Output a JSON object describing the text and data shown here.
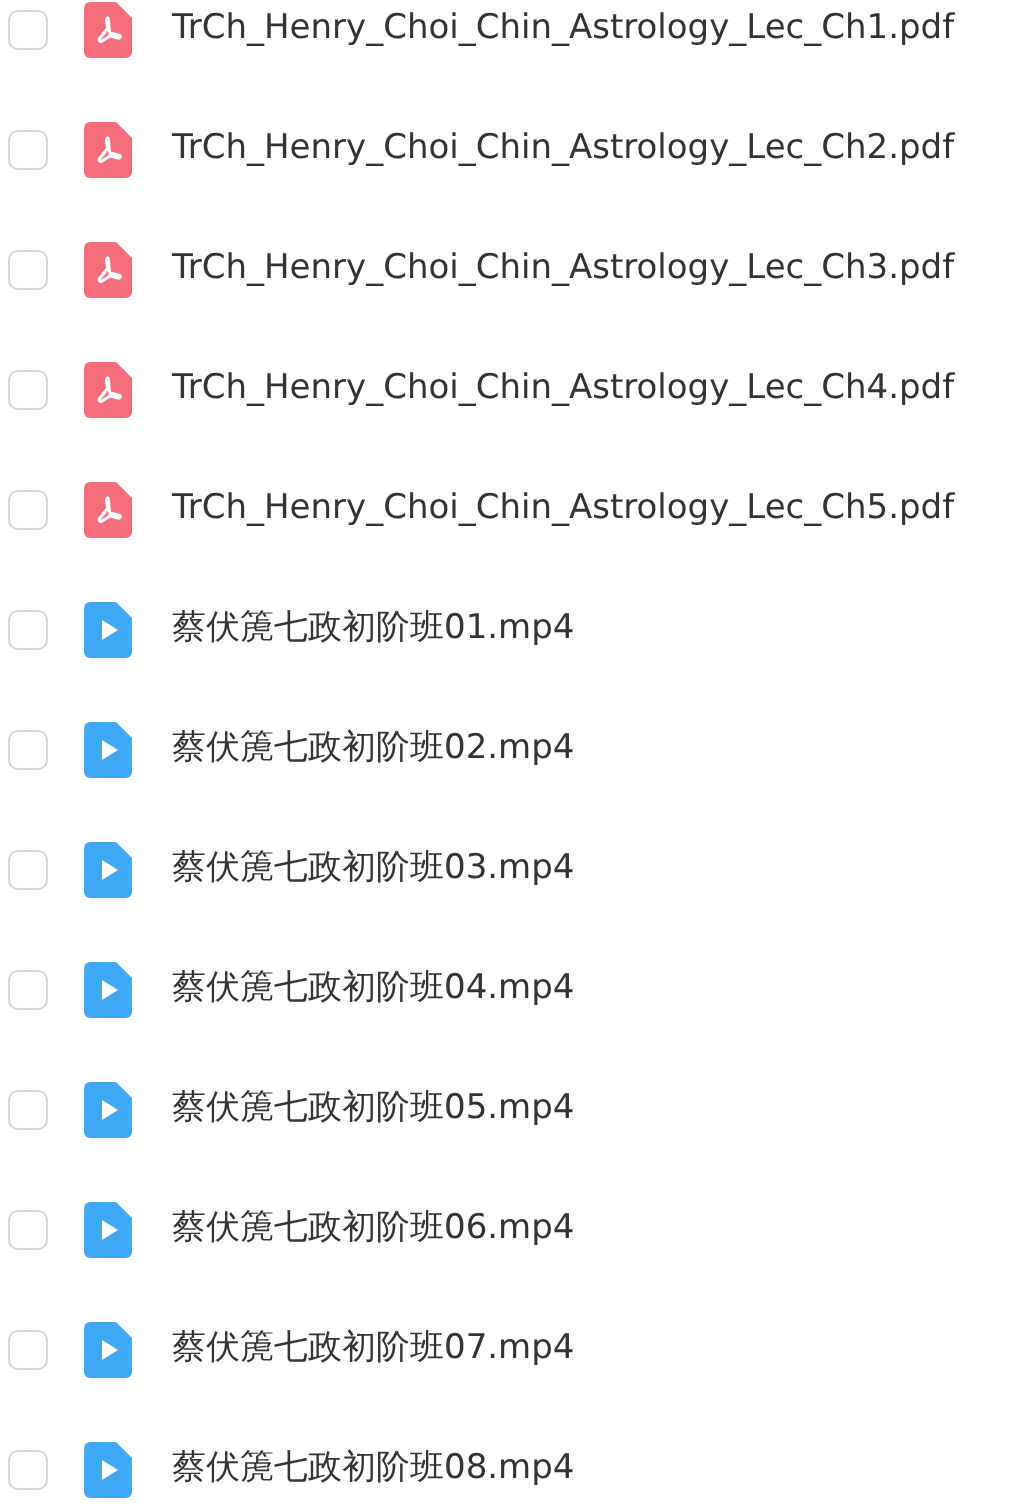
{
  "files": [
    {
      "kind": "pdf",
      "name": "TrCh_Henry_Choi_Chin_Astrology_Lec_Ch1.pdf",
      "checked": false
    },
    {
      "kind": "pdf",
      "name": "TrCh_Henry_Choi_Chin_Astrology_Lec_Ch2.pdf",
      "checked": false
    },
    {
      "kind": "pdf",
      "name": "TrCh_Henry_Choi_Chin_Astrology_Lec_Ch3.pdf",
      "checked": false
    },
    {
      "kind": "pdf",
      "name": "TrCh_Henry_Choi_Chin_Astrology_Lec_Ch4.pdf",
      "checked": false
    },
    {
      "kind": "pdf",
      "name": "TrCh_Henry_Choi_Chin_Astrology_Lec_Ch5.pdf",
      "checked": false
    },
    {
      "kind": "video",
      "name": "蔡伏箎七政初阶班01.mp4",
      "checked": false
    },
    {
      "kind": "video",
      "name": "蔡伏箎七政初阶班02.mp4",
      "checked": false
    },
    {
      "kind": "video",
      "name": "蔡伏箎七政初阶班03.mp4",
      "checked": false
    },
    {
      "kind": "video",
      "name": "蔡伏箎七政初阶班04.mp4",
      "checked": false
    },
    {
      "kind": "video",
      "name": "蔡伏箎七政初阶班05.mp4",
      "checked": false
    },
    {
      "kind": "video",
      "name": "蔡伏箎七政初阶班06.mp4",
      "checked": false
    },
    {
      "kind": "video",
      "name": "蔡伏箎七政初阶班07.mp4",
      "checked": false
    },
    {
      "kind": "video",
      "name": "蔡伏箎七政初阶班08.mp4",
      "checked": false
    }
  ]
}
